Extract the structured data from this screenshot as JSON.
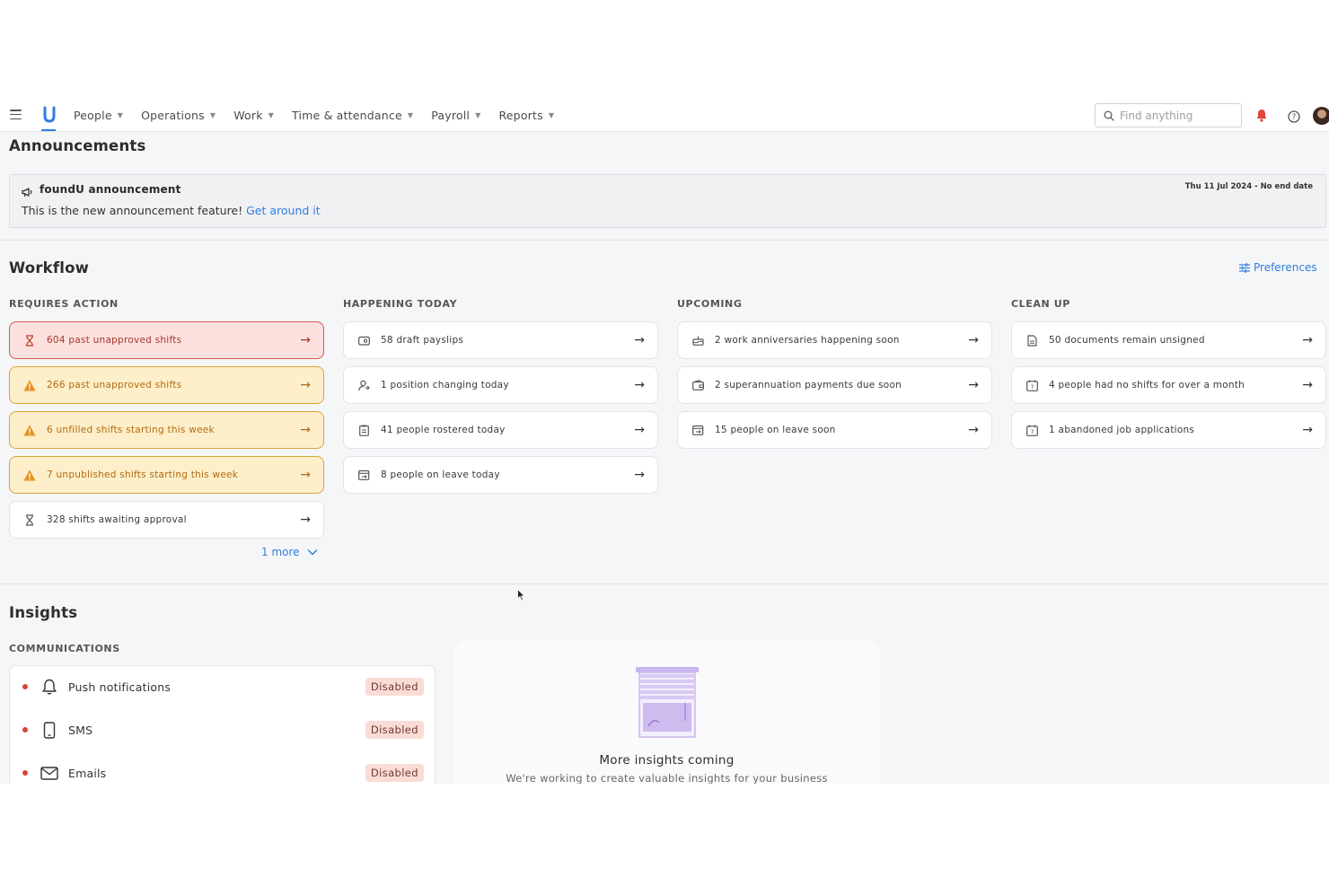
{
  "nav": {
    "items": [
      {
        "label": "People"
      },
      {
        "label": "Operations"
      },
      {
        "label": "Work"
      },
      {
        "label": "Time & attendance"
      },
      {
        "label": "Payroll"
      },
      {
        "label": "Reports"
      }
    ],
    "search_placeholder": "Find anything",
    "accent_color": "#2f7de1",
    "notification_color": "#e0443a"
  },
  "announcements": {
    "title": "Announcements",
    "card": {
      "heading": "foundU announcement",
      "body": "This is the new announcement feature!",
      "link": "Get around it",
      "date": "Thu 11 Jul 2024 - No end date"
    }
  },
  "workflow": {
    "title": "Workflow",
    "preferences_label": "Preferences",
    "columns": [
      {
        "heading": "REQUIRES ACTION",
        "items": [
          {
            "label": "604 past unapproved shifts",
            "style": "red",
            "icon": "hourglass-icon"
          },
          {
            "label": "266 past unapproved shifts",
            "style": "amber",
            "icon": "warning-icon"
          },
          {
            "label": "6 unfilled shifts starting this week",
            "style": "amber",
            "icon": "warning-icon"
          },
          {
            "label": "7 unpublished shifts starting this week",
            "style": "amber",
            "icon": "warning-icon"
          },
          {
            "label": "328 shifts awaiting approval",
            "style": "plain",
            "icon": "hourglass-icon"
          }
        ],
        "more_label": "1 more"
      },
      {
        "heading": "HAPPENING TODAY",
        "items": [
          {
            "label": "58 draft payslips",
            "icon": "payslip-icon"
          },
          {
            "label": "1 position changing today",
            "icon": "position-icon"
          },
          {
            "label": "41 people rostered today",
            "icon": "roster-icon"
          },
          {
            "label": "8 people on leave today",
            "icon": "leave-icon"
          }
        ]
      },
      {
        "heading": "UPCOMING",
        "items": [
          {
            "label": "2 work anniversaries happening soon",
            "icon": "cake-icon"
          },
          {
            "label": "2 superannuation payments due soon",
            "icon": "wallet-icon"
          },
          {
            "label": "15 people on leave soon",
            "icon": "leave-icon"
          }
        ]
      },
      {
        "heading": "CLEAN UP",
        "items": [
          {
            "label": "50 documents remain unsigned",
            "icon": "document-icon"
          },
          {
            "label": "4 people had no shifts for over a month",
            "icon": "calendar-question-icon"
          },
          {
            "label": "1 abandoned job applications",
            "icon": "calendar-question-icon"
          }
        ]
      }
    ]
  },
  "insights": {
    "title": "Insights",
    "communications": {
      "heading": "COMMUNICATIONS",
      "rows": [
        {
          "label": "Push notifications",
          "status": "Disabled",
          "icon": "bell-icon"
        },
        {
          "label": "SMS",
          "status": "Disabled",
          "icon": "phone-icon"
        },
        {
          "label": "Emails",
          "status": "Disabled",
          "icon": "mail-icon"
        }
      ]
    },
    "coming_soon": {
      "title": "More insights coming",
      "subtitle": "We're working to create valuable insights for your business"
    }
  }
}
